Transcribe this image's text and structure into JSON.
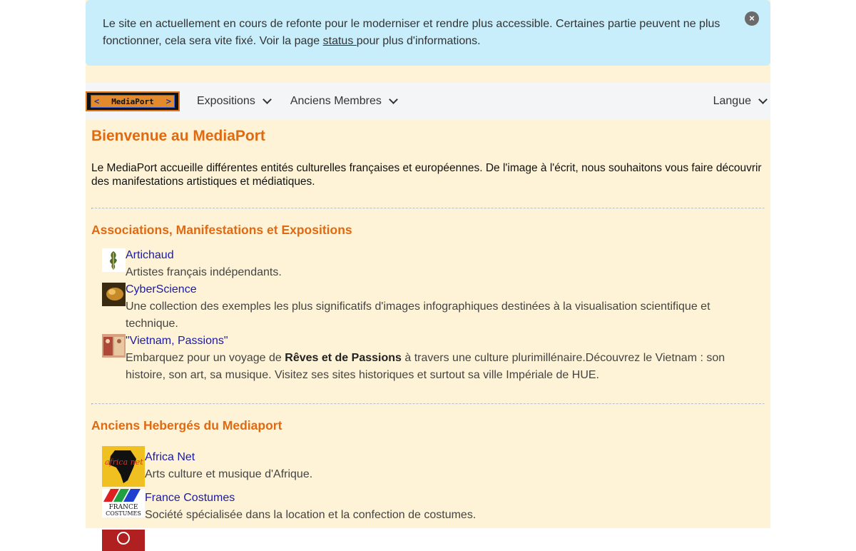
{
  "alert": {
    "text_before": "Le site en actuellement en cours de refonte pour le moderniser et rendre plus accessible. Certaines partie peuvent ne plus fonctionner, cela sera vite fixé. Voir la page ",
    "link_text": "status ",
    "text_after": "pour plus d'informations.",
    "close_label": "×"
  },
  "navbar": {
    "logo_text": "MediaPort",
    "items": [
      {
        "label": "Expositions"
      },
      {
        "label": "Anciens Membres"
      }
    ],
    "langue_label": "Langue"
  },
  "page": {
    "title": "Bienvenue au MediaPort",
    "intro": "Le MediaPort accueille différentes entités culturelles françaises et européennes. De l'image à l'écrit, nous souhaitons vous faire découvrir des manifestations artistiques et médiatiques."
  },
  "sections": [
    {
      "title": "Associations, Manifestations et Expositions",
      "entries": [
        {
          "name": "Artichaud",
          "desc": "Artistes français indépendants.",
          "icon": "artichaud-thumbnail"
        },
        {
          "name": "CyberScience",
          "desc": "Une collection des exemples les plus significatifs d'images infographiques destinées à la visualisation scientifique et technique.",
          "icon": "cyberscience-thumbnail"
        },
        {
          "name": "\"Vietnam, Passions\"",
          "desc_before": "Embarquez pour un voyage de ",
          "desc_bold": "Rêves et de Passions",
          "desc_after": " à travers une culture plurimillénaire.Découvrez le Vietnam : son histoire, son art, sa musique. Visitez ses sites historiques et surtout sa ville Impériale de HUE.",
          "icon": "vietnam-thumbnail"
        }
      ]
    },
    {
      "title": "Anciens Hebergés du Mediaport",
      "entries": [
        {
          "name": "Africa Net",
          "desc": "Arts culture et musique d'Afrique.",
          "icon": "africa-net-logo",
          "logo_text": "africa net"
        },
        {
          "name": "France Costumes",
          "desc": "Société spécialisée dans la location et la confection de costumes.",
          "icon": "france-costumes-logo",
          "logo_text_1": "FRANCE",
          "logo_text_2": "COSTUMES"
        }
      ]
    }
  ],
  "colors": {
    "alert_bg": "#c9eefb",
    "page_bg": "#fef3d6",
    "heading": "#e06a12",
    "link": "#1a1aa8",
    "navbar_bg": "#f4f5f7"
  }
}
